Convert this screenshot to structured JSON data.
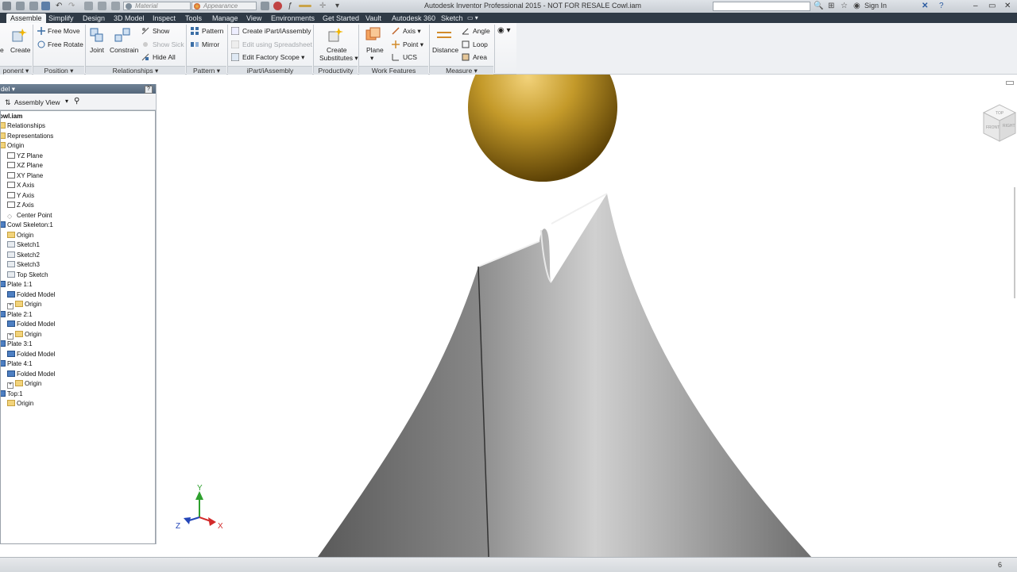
{
  "window": {
    "title": "Autodesk Inventor Professional 2015 - NOT FOR RESALE   Cowl.iam",
    "material_placeholder": "Material",
    "appearance_placeholder": "Appearance",
    "sign_in": "Sign In"
  },
  "tabs": [
    "Assemble",
    "Simplify",
    "Design",
    "3D Model",
    "Inspect",
    "Tools",
    "Manage",
    "View",
    "Environments",
    "Get Started",
    "Vault",
    "Autodesk 360",
    "Sketch"
  ],
  "ribbon": {
    "component": {
      "label": "ponent",
      "place": "e",
      "create": "Create"
    },
    "position": {
      "label": "Position",
      "free_move": "Free Move",
      "free_rotate": "Free Rotate"
    },
    "relationships": {
      "label": "Relationships",
      "joint": "Joint",
      "constrain": "Constrain",
      "show": "Show",
      "show_sick": "Show Sick",
      "hide_all": "Hide All"
    },
    "pattern": {
      "label": "Pattern",
      "pattern": "Pattern",
      "mirror": "Mirror"
    },
    "ipart": {
      "label": "iPart/iAssembly",
      "create": "Create iPart/iAssembly",
      "edit_spreadsheet": "Edit using Spreadsheet",
      "edit_factory": "Edit Factory Scope"
    },
    "productivity": {
      "label": "Productivity",
      "create": "Create",
      "substitutes": "Substitutes"
    },
    "work_features": {
      "label": "Work Features",
      "plane": "Plane",
      "axis": "Axis",
      "point": "Point",
      "ucs": "UCS"
    },
    "measure": {
      "label": "Measure",
      "distance": "Distance",
      "angle": "Angle",
      "loop": "Loop",
      "area": "Area"
    }
  },
  "browser": {
    "header": "del",
    "view": "Assembly View",
    "help": "?",
    "tree": [
      {
        "label": "owl.iam",
        "bold": true
      },
      {
        "label": "Relationships"
      },
      {
        "label": "Representations"
      },
      {
        "label": "Origin"
      },
      {
        "label": "YZ Plane"
      },
      {
        "label": "XZ Plane"
      },
      {
        "label": "XY Plane"
      },
      {
        "label": "X Axis"
      },
      {
        "label": "Y Axis"
      },
      {
        "label": "Z Axis"
      },
      {
        "label": "Center Point"
      },
      {
        "label": "Cowl Skeleton:1"
      },
      {
        "label": "Origin"
      },
      {
        "label": "Sketch1"
      },
      {
        "label": "Sketch2"
      },
      {
        "label": "Sketch3"
      },
      {
        "label": "Top Sketch"
      },
      {
        "label": "Plate 1:1"
      },
      {
        "label": "Folded Model"
      },
      {
        "label": "Origin"
      },
      {
        "label": "Plate 2:1"
      },
      {
        "label": "Folded Model"
      },
      {
        "label": "Origin"
      },
      {
        "label": "Plate 3:1"
      },
      {
        "label": "Folded Model"
      },
      {
        "label": "Plate 4:1"
      },
      {
        "label": "Folded Model"
      },
      {
        "label": "Origin"
      },
      {
        "label": "Top:1"
      },
      {
        "label": "Origin"
      }
    ]
  },
  "viewcube": {
    "top": "TOP",
    "front": "FRONT",
    "right": "RIGHT"
  },
  "triad": {
    "x": "X",
    "y": "Y",
    "z": "Z"
  },
  "status": {
    "page": "6"
  },
  "colors": {
    "tabbar": "#2f3a46",
    "sphere": "#c49a2a",
    "shell": "#9a9a9a",
    "x_axis": "#d22b2b",
    "y_axis": "#2ea02e",
    "z_axis": "#2446b8"
  }
}
